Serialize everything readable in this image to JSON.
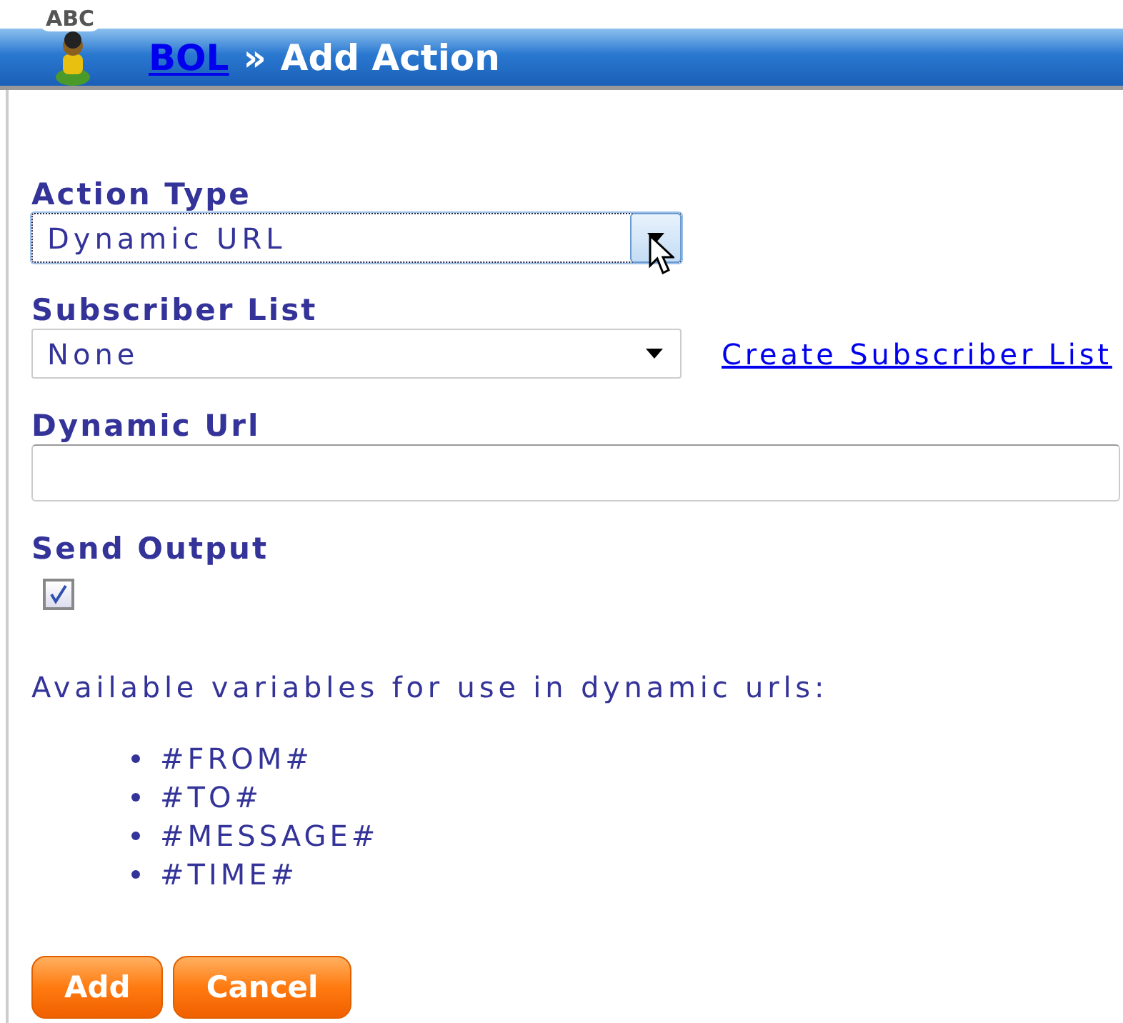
{
  "header": {
    "breadcrumb_link": "BOL",
    "separator": "»",
    "title": "Add Action",
    "logo_text": "ABC"
  },
  "fields": [
    {
      "kind": "select",
      "label": "Action Type",
      "value": "Dynamic URL",
      "focused": true
    },
    {
      "kind": "select",
      "label": "Subscriber List",
      "value": "None",
      "focused": false,
      "link": "Create Subscriber List"
    },
    {
      "kind": "text",
      "label": "Dynamic Url"
    },
    {
      "kind": "checkbox",
      "label": "Send Output",
      "checked": true
    }
  ],
  "help_text": "Available variables for use in dynamic urls:",
  "variables": [
    "#FROM#",
    "#TO#",
    "#MESSAGE#",
    "#TIME#"
  ],
  "buttons": [
    "Add",
    "Cancel"
  ]
}
